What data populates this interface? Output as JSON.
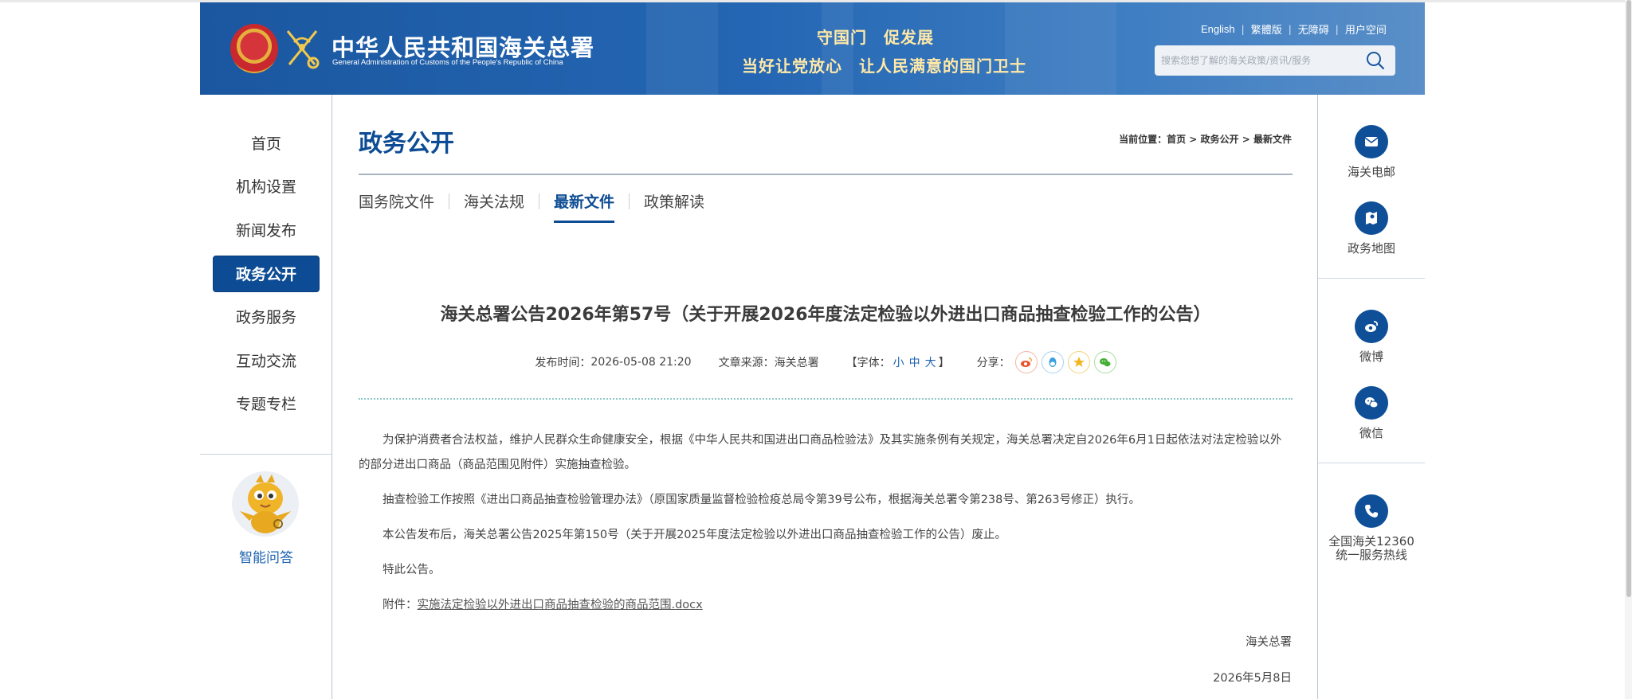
{
  "header": {
    "site_title": "中华人民共和国海关总署",
    "site_subtitle": "General Administration of Customs of the People's Republic of China",
    "slogan_line1": "守国门　促发展",
    "slogan_line2": "当好让党放心　让人民满意的国门卫士",
    "top_links": [
      "English",
      "繁體版",
      "无障碍",
      "用户空间"
    ],
    "search": {
      "placeholder": "搜索您想了解的海关政策/资讯/服务"
    },
    "colors": {
      "bg": "#1b57a0",
      "slogan": "#ffe9a8"
    }
  },
  "left_nav": {
    "items": [
      {
        "label": "首页",
        "active": false
      },
      {
        "label": "机构设置",
        "active": false
      },
      {
        "label": "新闻发布",
        "active": false
      },
      {
        "label": "政务公开",
        "active": true
      },
      {
        "label": "政务服务",
        "active": false
      },
      {
        "label": "互动交流",
        "active": false
      },
      {
        "label": "专题专栏",
        "active": false
      }
    ],
    "assistant_label": "智能问答",
    "active_color": "#0d4c94"
  },
  "main": {
    "page_title": "政务公开",
    "breadcrumb": {
      "prefix": "当前位置：",
      "items": [
        "首页",
        "政务公开",
        "最新文件"
      ],
      "separator": " > "
    },
    "tabs": [
      {
        "label": "国务院文件",
        "active": false
      },
      {
        "label": "海关法规",
        "active": false
      },
      {
        "label": "最新文件",
        "active": true
      },
      {
        "label": "政策解读",
        "active": false
      }
    ],
    "article": {
      "title": "海关总署公告2026年第57号（关于开展2026年度法定检验以外进出口商品抽查检验工作的公告）",
      "meta": {
        "publish_label": "发布时间：",
        "publish_time": "2026-05-08 21:20",
        "source_label": "文章来源：",
        "source": "海关总署",
        "font_label_open": "【字体：",
        "font_small": "小",
        "font_medium": "中",
        "font_large": "大",
        "font_label_close": "】",
        "share_label": "分享："
      },
      "share_icons": [
        "weibo-icon",
        "qq-icon",
        "qzone-icon",
        "wechat-icon"
      ],
      "paragraphs": [
        "为保护消费者合法权益，维护人民群众生命健康安全，根据《中华人民共和国进出口商品检验法》及其实施条例有关规定，海关总署决定自2026年6月1日起依法对法定检验以外的部分进出口商品（商品范围见附件）实施抽查检验。",
        "抽查检验工作按照《进出口商品抽查检验管理办法》（原国家质量监督检验检疫总局令第39号公布，根据海关总署令第238号、第263号修正）执行。",
        "本公告发布后，海关总署公告2025年第150号（关于开展2025年度法定检验以外进出口商品抽查检验工作的公告）废止。",
        "特此公告。"
      ],
      "attachment_label": "附件：",
      "attachment_name": "实施法定检验以外进出口商品抽查检验的商品范围.docx",
      "signature": "海关总署",
      "sign_date": "2026年5月8日"
    }
  },
  "right_panel": {
    "items": [
      {
        "label": "海关电邮",
        "icon": "mail-icon"
      },
      {
        "label": "政务地图",
        "icon": "map-icon"
      },
      {
        "label": "微博",
        "icon": "weibo-icon"
      },
      {
        "label": "微信",
        "icon": "wechat-icon"
      },
      {
        "label_line1": "全国海关12360",
        "label_line2": "统一服务热线",
        "icon": "phone-icon"
      }
    ]
  }
}
